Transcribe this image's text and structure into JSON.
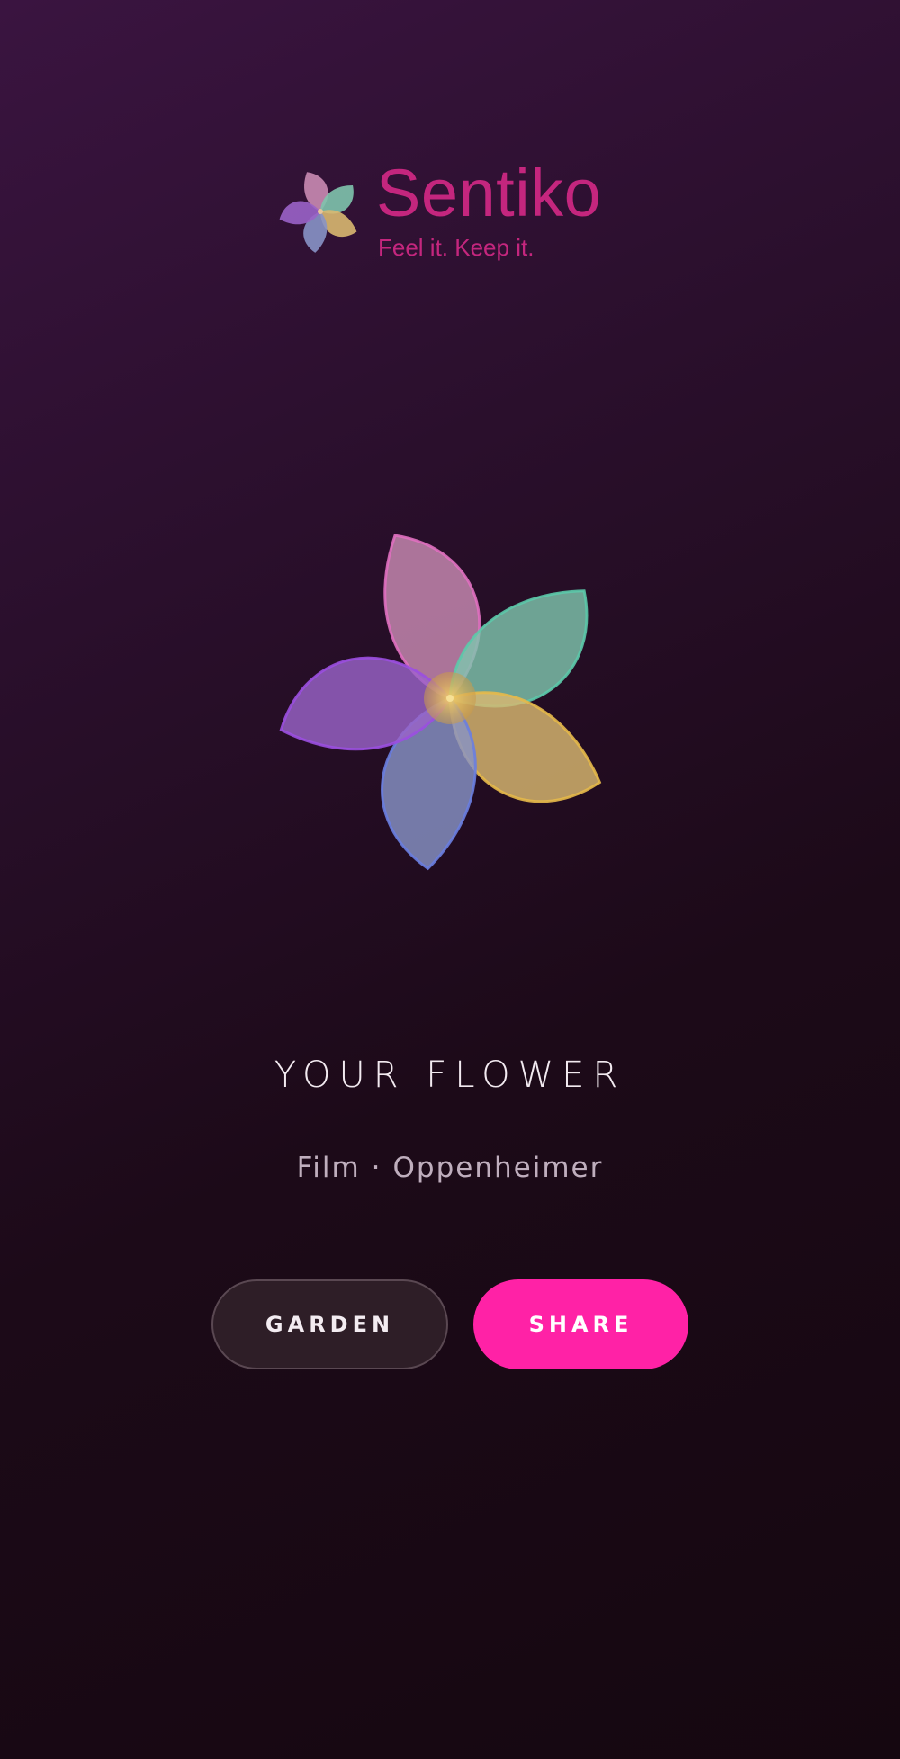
{
  "brand": {
    "name": "Sentiko",
    "tagline": "Feel it. Keep it.",
    "logo_icon": "flower-logo-icon"
  },
  "flower": {
    "icon": "flower-icon",
    "petal_colors": [
      "#c98bb3",
      "#7fc4ad",
      "#d9b870",
      "#8893c6",
      "#9a63c8"
    ],
    "petal_stroke_colors": [
      "#e070c0",
      "#5cc9aa",
      "#e6b94a",
      "#6a7ee0",
      "#9b4fe0"
    ],
    "center_color": "#d6a94e"
  },
  "main": {
    "title": "YOUR FLOWER",
    "category": "Film",
    "separator": "·",
    "item": "Oppenheimer"
  },
  "actions": {
    "garden_label": "GARDEN",
    "share_label": "SHARE"
  },
  "colors": {
    "accent": "#ff22a6",
    "brand": "#c4267e",
    "background_top": "#3a1440",
    "background_bottom": "#150710"
  }
}
